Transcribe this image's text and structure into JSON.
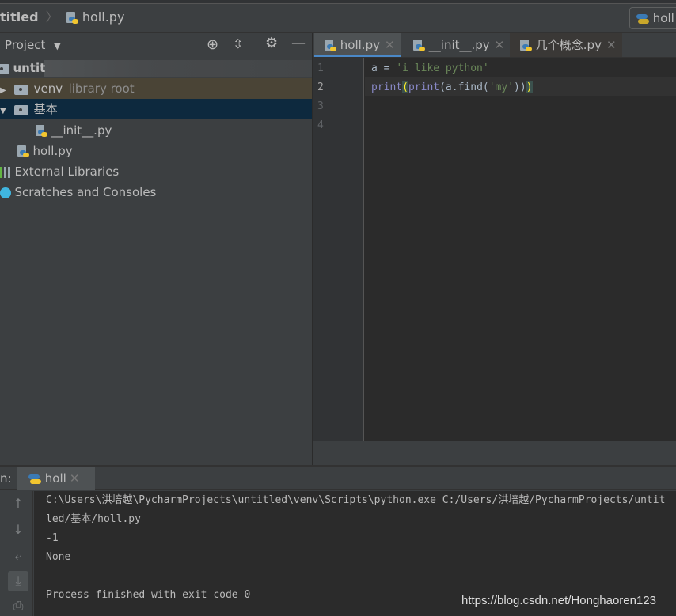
{
  "breadcrumb": {
    "project": "titled",
    "file": "holl.py"
  },
  "run_config": {
    "label": "holl"
  },
  "project_panel": {
    "title": "Project",
    "tree": [
      {
        "label": "untit",
        "bold": true
      },
      {
        "label": "venv",
        "suffix": "library root"
      },
      {
        "label": "基本"
      },
      {
        "label": "__init__.py"
      },
      {
        "label": "holl.py"
      },
      {
        "label": "External Libraries"
      },
      {
        "label": "Scratches and Consoles"
      }
    ]
  },
  "editor": {
    "tabs": [
      {
        "label": "holl.py",
        "active": true
      },
      {
        "label": "__init__.py"
      },
      {
        "label": "几个概念.py"
      }
    ],
    "lines": [
      {
        "n": "1"
      },
      {
        "n": "2"
      },
      {
        "n": "3"
      },
      {
        "n": "4"
      }
    ],
    "code": {
      "l1_var": "a = ",
      "l1_str": "'i like python'",
      "l2_a": "print",
      "l2_b": "(",
      "l2_c": "print",
      "l2_d": "(a.find(",
      "l2_e": "'my'",
      "l2_f": "))",
      "l2_g": ")"
    }
  },
  "run": {
    "label": "n:",
    "tab": "holl",
    "output": [
      "C:\\Users\\洪培越\\PycharmProjects\\untitled\\venv\\Scripts\\python.exe C:/Users/洪培越/PycharmProjects/untitled/基本/holl.py",
      "-1",
      "None",
      "",
      "Process finished with exit code 0"
    ]
  },
  "watermark": "https://blog.csdn.net/Honghaoren123",
  "colors": {
    "selection": "#0d293e",
    "library_root": "#4a4436",
    "accent": "#4a88c7"
  }
}
